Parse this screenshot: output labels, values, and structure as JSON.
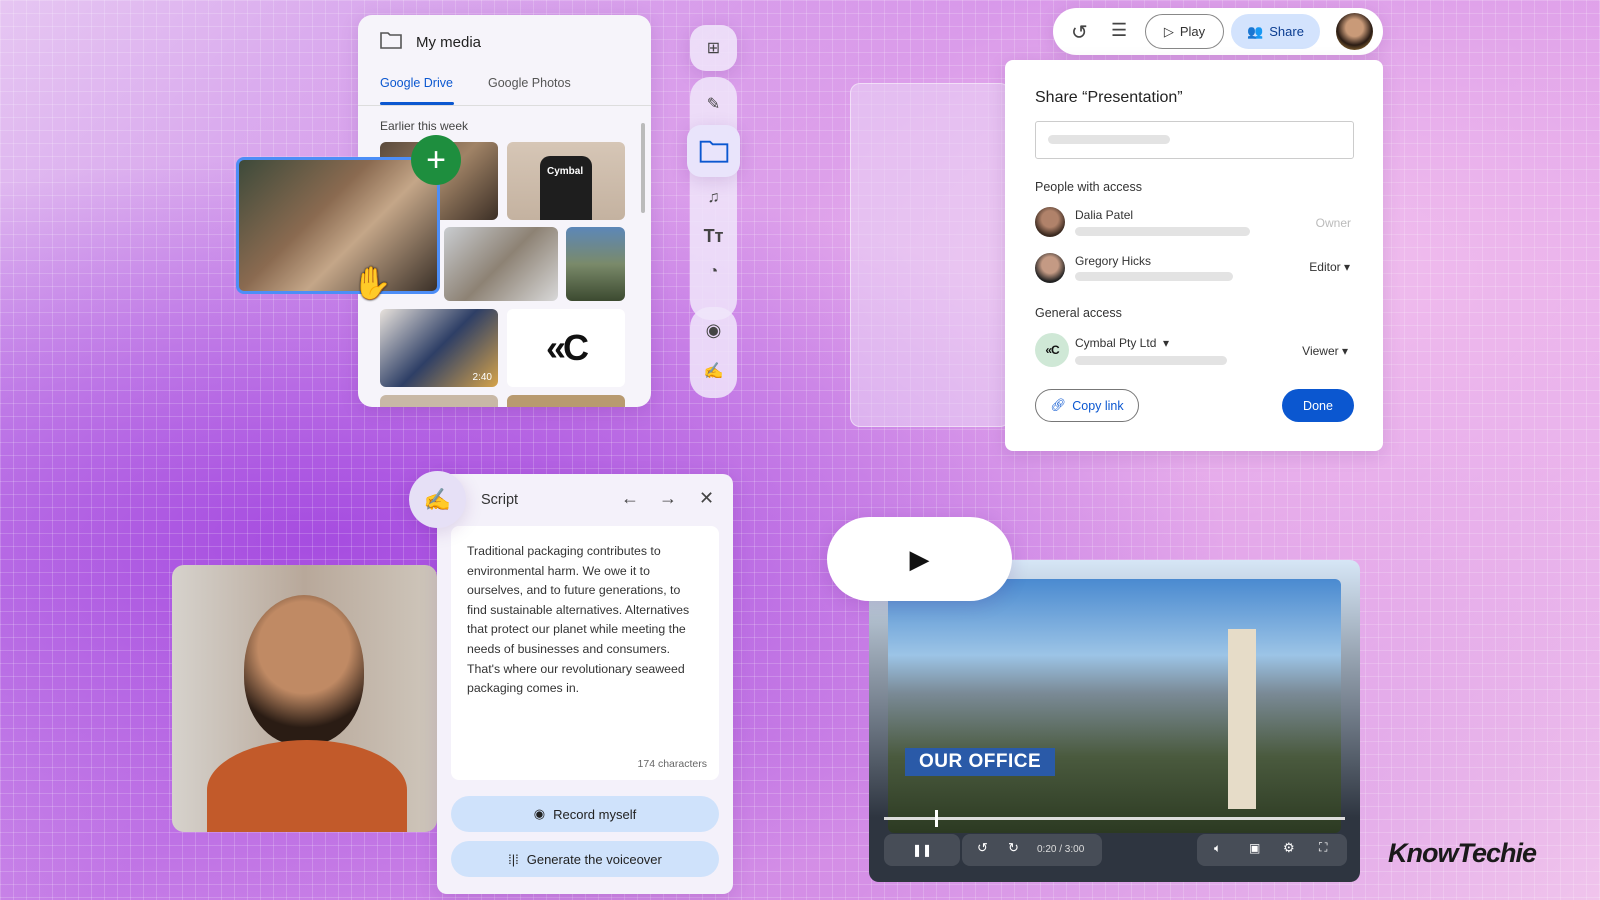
{
  "media": {
    "title": "My media",
    "tabs": [
      {
        "label": "Google Drive",
        "active": true
      },
      {
        "label": "Google Photos",
        "active": false
      }
    ],
    "section": "Earlier this week",
    "tshirt_text": "Cymbal",
    "video_duration": "2:40",
    "logo_text": "«C"
  },
  "toolbar": {
    "icons": [
      "add-image-icon",
      "edit-image-icon",
      "folder-icon",
      "media-icon",
      "text-icon",
      "shapes-icon",
      "record-icon",
      "script-icon"
    ]
  },
  "topbar": {
    "play_label": "Play",
    "share_label": "Share"
  },
  "share": {
    "title": "Share “Presentation”",
    "people_heading": "People with access",
    "people": [
      {
        "name": "Dalia Patel",
        "role": "Owner"
      },
      {
        "name": "Gregory Hicks",
        "role": "Editor"
      }
    ],
    "general_heading": "General access",
    "org": "Cymbal Pty Ltd",
    "org_logo": "«C",
    "org_role": "Viewer",
    "copy_link": "Copy link",
    "done": "Done",
    "accent": "#0b57d0"
  },
  "script": {
    "title": "Script",
    "text": "Traditional packaging contributes to environmental harm. We owe it to ourselves, and to future generations, to find sustainable alternatives. Alternatives that protect our planet while meeting the needs of businesses and consumers. That's where our revolutionary seaweed packaging comes in.",
    "char_count": "174 characters",
    "record_label": "Record myself",
    "voiceover_label": "Generate the voiceover"
  },
  "video": {
    "caption": "OUR OFFICE",
    "time": "0:20 / 3:00",
    "progress": 0.11
  },
  "watermark": "KnowTechie"
}
